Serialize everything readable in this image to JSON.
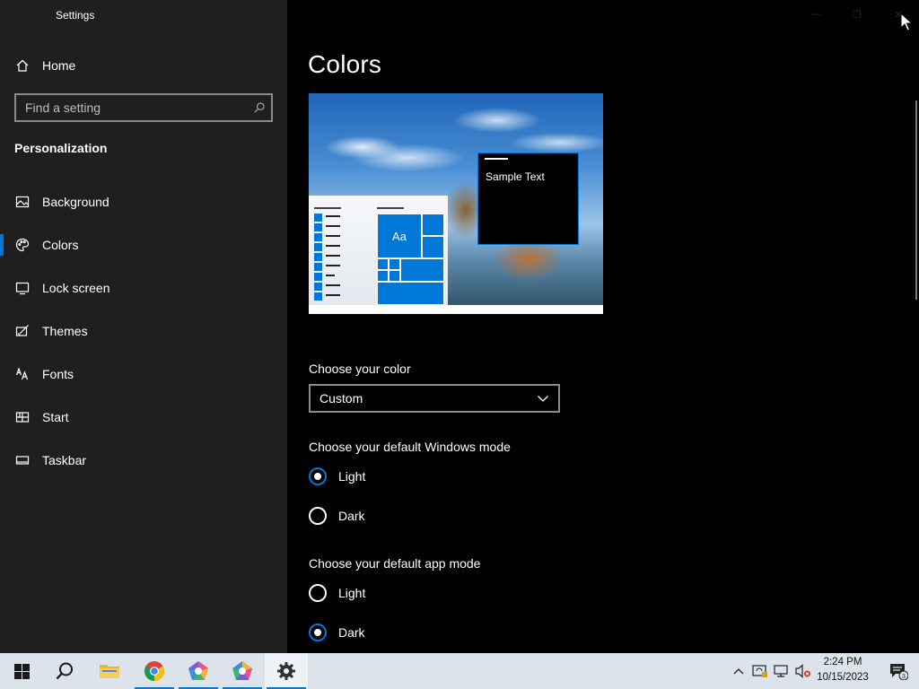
{
  "window": {
    "title": "Settings"
  },
  "sidebar": {
    "home_label": "Home",
    "search_placeholder": "Find a setting",
    "section_title": "Personalization",
    "items": [
      {
        "label": "Background",
        "icon": "picture-icon"
      },
      {
        "label": "Colors",
        "icon": "palette-icon",
        "active": true
      },
      {
        "label": "Lock screen",
        "icon": "lock-screen-icon"
      },
      {
        "label": "Themes",
        "icon": "themes-brush-icon"
      },
      {
        "label": "Fonts",
        "icon": "fonts-icon"
      },
      {
        "label": "Start",
        "icon": "start-tiles-icon"
      },
      {
        "label": "Taskbar",
        "icon": "taskbar-icon"
      }
    ]
  },
  "main": {
    "title": "Colors",
    "preview": {
      "sample_text": "Sample Text",
      "tile_text": "Aa"
    },
    "choose_color": {
      "label": "Choose your color",
      "selected": "Custom"
    },
    "windows_mode": {
      "label": "Choose your default Windows mode",
      "options": [
        {
          "label": "Light",
          "checked": true
        },
        {
          "label": "Dark",
          "checked": false
        }
      ]
    },
    "app_mode": {
      "label": "Choose your default app mode",
      "options": [
        {
          "label": "Light",
          "checked": false
        },
        {
          "label": "Dark",
          "checked": true
        }
      ]
    }
  },
  "taskbar": {
    "time": "2:24 PM",
    "date": "10/15/2023",
    "notification_count": "3"
  },
  "colors": {
    "accent": "#0078d7",
    "sidebar_bg": "#1f1f1f",
    "main_bg": "#000000",
    "taskbar_bg": "#dce3ea"
  }
}
